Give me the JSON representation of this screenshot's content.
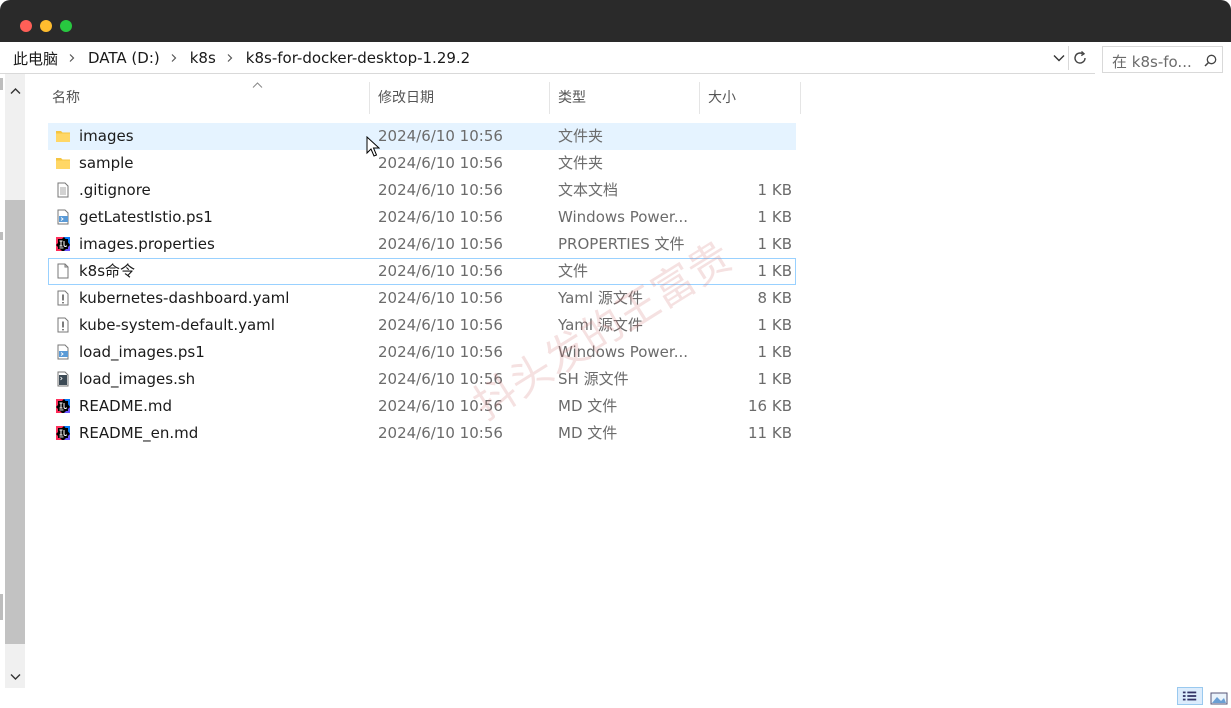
{
  "window": {
    "controls": [
      "close",
      "minimize",
      "maximize"
    ]
  },
  "breadcrumb": [
    "此电脑",
    "DATA (D:)",
    "k8s",
    "k8s-for-docker-desktop-1.29.2"
  ],
  "search": {
    "placeholder": "在 k8s-fo..."
  },
  "columns": {
    "name": "名称",
    "date": "修改日期",
    "type": "类型",
    "size": "大小"
  },
  "files": [
    {
      "name": "images",
      "date": "2024/6/10 10:56",
      "type": "文件夹",
      "size": "",
      "icon": "folder-icon",
      "state": "selected"
    },
    {
      "name": "sample",
      "date": "2024/6/10 10:56",
      "type": "文件夹",
      "size": "",
      "icon": "folder-icon"
    },
    {
      "name": ".gitignore",
      "date": "2024/6/10 10:56",
      "type": "文本文档",
      "size": "1 KB",
      "icon": "text-file-icon"
    },
    {
      "name": "getLatestIstio.ps1",
      "date": "2024/6/10 10:56",
      "type": "Windows Power...",
      "size": "1 KB",
      "icon": "powershell-file-icon"
    },
    {
      "name": "images.properties",
      "date": "2024/6/10 10:56",
      "type": "PROPERTIES 文件",
      "size": "1 KB",
      "icon": "intellij-file-icon"
    },
    {
      "name": "k8s命令",
      "date": "2024/6/10 10:56",
      "type": "文件",
      "size": "1 KB",
      "icon": "blank-file-icon",
      "state": "focused"
    },
    {
      "name": "kubernetes-dashboard.yaml",
      "date": "2024/6/10 10:56",
      "type": "Yaml 源文件",
      "size": "8 KB",
      "icon": "yaml-file-icon"
    },
    {
      "name": "kube-system-default.yaml",
      "date": "2024/6/10 10:56",
      "type": "Yaml 源文件",
      "size": "1 KB",
      "icon": "yaml-file-icon"
    },
    {
      "name": "load_images.ps1",
      "date": "2024/6/10 10:56",
      "type": "Windows Power...",
      "size": "1 KB",
      "icon": "powershell-file-icon"
    },
    {
      "name": "load_images.sh",
      "date": "2024/6/10 10:56",
      "type": "SH 源文件",
      "size": "1 KB",
      "icon": "shell-file-icon"
    },
    {
      "name": "README.md",
      "date": "2024/6/10 10:56",
      "type": "MD 文件",
      "size": "16 KB",
      "icon": "intellij-file-icon"
    },
    {
      "name": "README_en.md",
      "date": "2024/6/10 10:56",
      "type": "MD 文件",
      "size": "11 KB",
      "icon": "intellij-file-icon"
    }
  ],
  "watermark": "抖头发的王富贵",
  "colors": {
    "selected_row": "#e5f3ff",
    "focus_outline": "#99d1ff",
    "folder": "#f5c542",
    "titlebar": "#2a2a2a"
  }
}
